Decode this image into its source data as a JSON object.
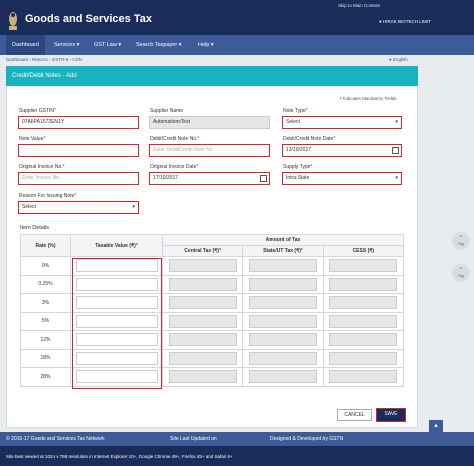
{
  "header": {
    "skip_link": "Skip to Main Content",
    "title": "Goods and Services Tax",
    "user": "HIRAK BIOTECH LIMIT"
  },
  "nav": {
    "dashboard": "Dashboard",
    "services": "Services ▾",
    "gst_law": "GST Law ▾",
    "search_taxpayer": "Search Taxpayer ▾",
    "help": "Help ▾"
  },
  "breadcrumb": {
    "text": "Dashboard › Returns › GSTR-6 › CDN",
    "language": "● English"
  },
  "card": {
    "title": "Credit/Debit Notes - Add",
    "mandatory_note": "Indicates Mandatory Fields"
  },
  "form": {
    "supplier_gstin": {
      "label": "Supplier GSTIN",
      "value": "07AIIPA1572EN1Y"
    },
    "supplier_name": {
      "label": "Supplier Name",
      "value": "AutomationsTest"
    },
    "note_type": {
      "label": "Note Type",
      "value": "Select"
    },
    "note_value": {
      "label": "Note Value",
      "value": ""
    },
    "note_no": {
      "label": "Debit/Credit Note No.",
      "placeholder": "Enter Debit/Credit Note No."
    },
    "note_date": {
      "label": "Debit/Credit Note Date",
      "value": "13/10/2017"
    },
    "orig_invoice_no": {
      "label": "Original Invoice No.",
      "placeholder": "Enter Invoice No."
    },
    "orig_invoice_date": {
      "label": "Original Invoice Date",
      "value": "17/10/2017"
    },
    "supply_type": {
      "label": "Supply Type",
      "value": "Intra-State"
    },
    "reason": {
      "label": "Reason For Issuing Note",
      "value": "Select"
    }
  },
  "items": {
    "title": "Item Details",
    "headers": {
      "rate": "Rate (%)",
      "taxable": "Taxable Value (₹)",
      "amount_tax": "Amount of Tax",
      "central": "Central Tax (₹)",
      "state": "State/UT Tax (₹)",
      "cess": "CESS (₹)"
    },
    "rates": [
      "0%",
      "0.25%",
      "3%",
      "5%",
      "12%",
      "18%",
      "28%"
    ]
  },
  "buttons": {
    "cancel": "CANCEL",
    "save": "SAVE",
    "top": "Top"
  },
  "footer": {
    "copyright": "© 2016-17 Goods and Services Tax Network",
    "updated": "Site Last Updated on",
    "developed": "Designed & Developed by GSTN",
    "browser": "Site best viewed at 1024 x 768 resolution in Internet Explorer 10+, Google Chrome 49+, Firefox 45+ and Safari 6+"
  }
}
